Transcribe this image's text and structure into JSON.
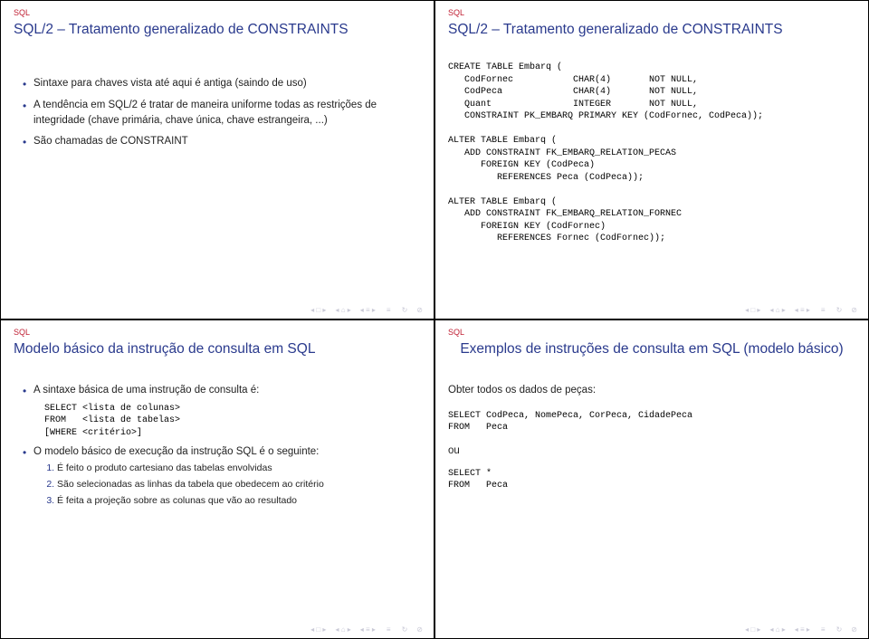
{
  "slides": {
    "tl": {
      "header": "SQL",
      "title": "SQL/2 – Tratamento generalizado de CONSTRAINTS",
      "bullets": [
        "Sintaxe para chaves vista até aqui é antiga (saindo de uso)",
        "A tendência em SQL/2 é tratar de maneira uniforme todas as restrições de integridade (chave primária, chave única, chave estrangeira, ...)",
        "São chamadas de CONSTRAINT"
      ]
    },
    "tr": {
      "header": "SQL",
      "title": "SQL/2 – Tratamento generalizado de CONSTRAINTS",
      "code": "CREATE TABLE Embarq (\n   CodFornec           CHAR(4)       NOT NULL,\n   CodPeca             CHAR(4)       NOT NULL,\n   Quant               INTEGER       NOT NULL,\n   CONSTRAINT PK_EMBARQ PRIMARY KEY (CodFornec, CodPeca));\n\nALTER TABLE Embarq (\n   ADD CONSTRAINT FK_EMBARQ_RELATION_PECAS\n      FOREIGN KEY (CodPeca)\n         REFERENCES Peca (CodPeca));\n\nALTER TABLE Embarq (\n   ADD CONSTRAINT FK_EMBARQ_RELATION_FORNEC\n      FOREIGN KEY (CodFornec)\n         REFERENCES Fornec (CodFornec));"
    },
    "bl": {
      "header": "SQL",
      "title": "Modelo básico da instrução de consulta em SQL",
      "bullet1": "A sintaxe básica de uma instrução de consulta é:",
      "code1": "SELECT <lista de colunas>\nFROM   <lista de tabelas>\n[WHERE <critério>]",
      "bullet2": "O modelo básico de execução da instrução SQL é o seguinte:",
      "steps": [
        "É feito o produto cartesiano das tabelas envolvidas",
        "São selecionadas as linhas da tabela que obedecem ao critério",
        "É feita a projeção sobre as colunas que vão ao resultado"
      ]
    },
    "br": {
      "header": "SQL",
      "title": "Exemplos de instruções de consulta em SQL (modelo básico)",
      "intro": "Obter todos os dados de peças:",
      "code1": "SELECT CodPeca, NomePeca, CorPeca, CidadePeca\nFROM   Peca",
      "or": "ou",
      "code2": "SELECT *\nFROM   Peca"
    }
  },
  "nav": {
    "i1": "◂ □ ▸",
    "i2": "◂ ⌂ ▸",
    "i3": "◂ ≡ ▸",
    "i4": "≡",
    "i5": "↻",
    "i6": "⊘"
  }
}
